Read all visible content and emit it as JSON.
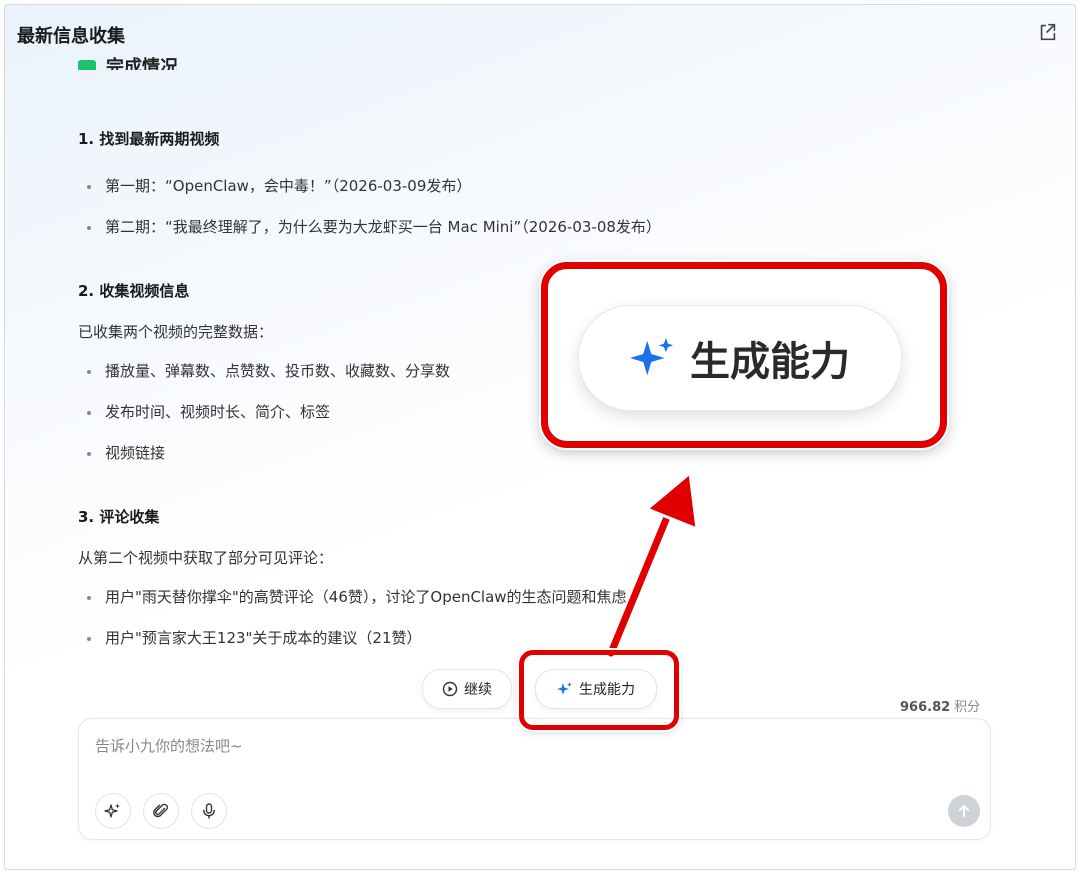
{
  "header": {
    "title": "最新信息收集",
    "share_icon": "share-export-icon"
  },
  "content": {
    "cut_heading": "完成情况",
    "sections": [
      {
        "title": "1. 找到最新两期视频",
        "intro": "",
        "items": [
          "第一期：“OpenClaw，会中毒！”（2026-03-09发布）",
          "第二期：“我最终理解了，为什么要为大龙虾买一台 Mac Mini”（2026-03-08发布）"
        ]
      },
      {
        "title": "2. 收集视频信息",
        "intro": "已收集两个视频的完整数据：",
        "items": [
          "播放量、弹幕数、点赞数、投币数、收藏数、分享数",
          "发布时间、视频时长、简介、标签",
          "视频链接"
        ]
      },
      {
        "title": "3. 评论收集",
        "intro": "从第二个视频中获取了部分可见评论：",
        "items": [
          "用户\"雨天替你撑伞\"的高赞评论（46赞），讨论了OpenClaw的生态问题和焦虑",
          "用户\"预言家大王123\"关于成本的建议（21赞）"
        ]
      }
    ]
  },
  "actions": {
    "continue_label": "继续",
    "generate_label": "生成能力"
  },
  "credits": {
    "value": "966.82",
    "unit": "积分"
  },
  "composer": {
    "placeholder": "告诉小九你的想法吧~",
    "value": ""
  },
  "annotation": {
    "zoom_label": "生成能力",
    "color": "#e10000"
  },
  "colors": {
    "accent_blue": "#1a73e8",
    "check_green": "#1ec26a"
  }
}
